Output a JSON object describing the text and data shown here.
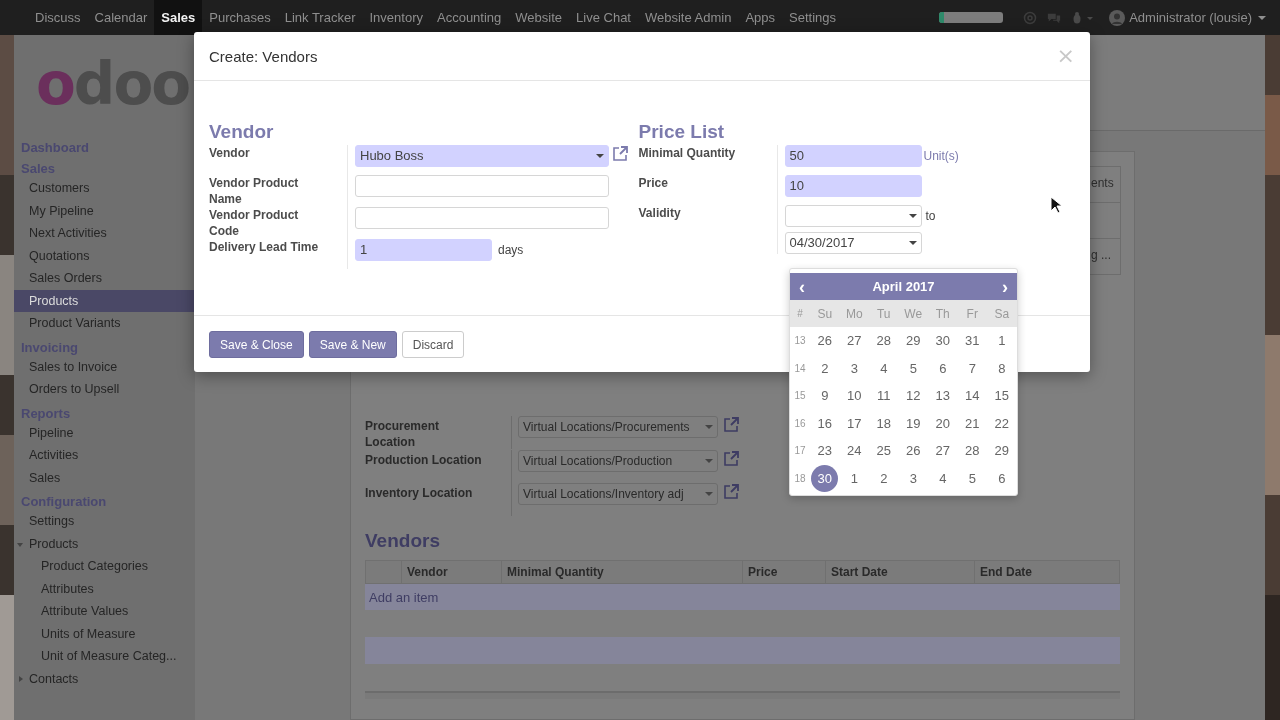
{
  "navbar": {
    "menus": [
      {
        "label": "Discuss",
        "selected": false
      },
      {
        "label": "Calendar",
        "selected": false
      },
      {
        "label": "Sales",
        "selected": true
      },
      {
        "label": "Purchases",
        "selected": false
      },
      {
        "label": "Link Tracker",
        "selected": false
      },
      {
        "label": "Inventory",
        "selected": false
      },
      {
        "label": "Accounting",
        "selected": false
      },
      {
        "label": "Website",
        "selected": false
      },
      {
        "label": "Live Chat",
        "selected": false
      },
      {
        "label": "Website Admin",
        "selected": false
      },
      {
        "label": "Apps",
        "selected": false
      },
      {
        "label": "Settings",
        "selected": false
      }
    ],
    "progress": {
      "level": 0.08
    },
    "user": "Administrator (lousie)"
  },
  "sidebar": {
    "logo": "odoo",
    "sections": [
      {
        "title": "Dashboard"
      },
      {
        "title": "Sales",
        "items": [
          {
            "label": "Customers",
            "selected": false,
            "kind": "leaf"
          },
          {
            "label": "My Pipeline",
            "selected": false,
            "kind": "leaf"
          },
          {
            "label": "Next Activities",
            "selected": false,
            "kind": "leaf"
          },
          {
            "label": "Quotations",
            "selected": false,
            "kind": "leaf"
          },
          {
            "label": "Sales Orders",
            "selected": false,
            "kind": "leaf"
          },
          {
            "label": "Products",
            "selected": true,
            "kind": "leaf"
          },
          {
            "label": "Product Variants",
            "selected": false,
            "kind": "leaf"
          }
        ]
      },
      {
        "title": "Invoicing",
        "items": [
          {
            "label": "Sales to Invoice",
            "selected": false,
            "kind": "leaf"
          },
          {
            "label": "Orders to Upsell",
            "selected": false,
            "kind": "leaf"
          }
        ]
      },
      {
        "title": "Reports",
        "items": [
          {
            "label": "Pipeline",
            "selected": false,
            "kind": "leaf"
          },
          {
            "label": "Activities",
            "selected": false,
            "kind": "leaf"
          },
          {
            "label": "Sales",
            "selected": false,
            "kind": "leaf"
          }
        ]
      },
      {
        "title": "Configuration",
        "items": [
          {
            "label": "Settings",
            "selected": false,
            "kind": "leaf"
          },
          {
            "label": "Products",
            "selected": false,
            "kind": "group",
            "expanded": true,
            "children": [
              {
                "label": "Product Categories",
                "selected": false
              },
              {
                "label": "Attributes",
                "selected": false
              },
              {
                "label": "Attribute Values",
                "selected": false
              },
              {
                "label": "Units of Measure",
                "selected": false
              },
              {
                "label": "Unit of Measure Categ...",
                "selected": false
              }
            ]
          },
          {
            "label": "Contacts",
            "selected": false,
            "kind": "group",
            "expanded": false
          }
        ]
      }
    ]
  },
  "page": {
    "stat_buttons": [
      "ents",
      "g ..."
    ],
    "locations": [
      {
        "label": "Procurement Location",
        "value": "Virtual Locations/Procurements"
      },
      {
        "label": "Production Location",
        "value": "Virtual Locations/Production"
      },
      {
        "label": "Inventory Location",
        "value": "Virtual Locations/Inventory adj"
      }
    ],
    "vendors": {
      "title": "Vendors",
      "columns": [
        "Vendor",
        "Minimal Quantity",
        "Price",
        "Start Date",
        "End Date"
      ],
      "add_item": "Add an item"
    }
  },
  "modal": {
    "title": "Create: Vendors",
    "close": "×",
    "groups": [
      {
        "title": "Vendor",
        "fields": [
          {
            "label": "Vendor",
            "kind": "select",
            "value": "Hubo Boss",
            "required": true,
            "link": true
          },
          {
            "label": "Vendor Product Name",
            "kind": "text",
            "required": false
          },
          {
            "label": "Vendor Product Code",
            "kind": "text",
            "required": false
          },
          {
            "label": "Delivery Lead Time",
            "kind": "text",
            "value": "1",
            "required": true,
            "unit": "days"
          }
        ]
      },
      {
        "title": "Price List",
        "fields": [
          {
            "label": "Minimal Quantity",
            "kind": "text",
            "value": "50",
            "required": true,
            "unit": "Unit(s)"
          },
          {
            "label": "Price",
            "kind": "text",
            "value": "10",
            "required": true
          },
          {
            "label": "Validity",
            "kind": "daterange",
            "separator": "to",
            "end": "04/30/2017"
          }
        ]
      }
    ],
    "buttons": [
      {
        "label": "Save & Close",
        "kind": "primary"
      },
      {
        "label": "Save & New",
        "kind": "primary"
      },
      {
        "label": "Discard",
        "kind": "default"
      }
    ]
  },
  "calendar": {
    "month": "April 2017",
    "prev": "‹",
    "next": "›",
    "week_header": "#",
    "weekdays": [
      "Su",
      "Mo",
      "Tu",
      "We",
      "Th",
      "Fr",
      "Sa"
    ],
    "weeks": [
      {
        "week": "13",
        "days": [
          {
            "d": "26",
            "selected": false
          },
          {
            "d": "27",
            "selected": false
          },
          {
            "d": "28",
            "selected": false
          },
          {
            "d": "29",
            "selected": false
          },
          {
            "d": "30",
            "selected": false
          },
          {
            "d": "31",
            "selected": false
          },
          {
            "d": "1",
            "selected": false
          }
        ]
      },
      {
        "week": "14",
        "days": [
          {
            "d": "2",
            "selected": false
          },
          {
            "d": "3",
            "selected": false
          },
          {
            "d": "4",
            "selected": false
          },
          {
            "d": "5",
            "selected": false
          },
          {
            "d": "6",
            "selected": false
          },
          {
            "d": "7",
            "selected": false
          },
          {
            "d": "8",
            "selected": false
          }
        ]
      },
      {
        "week": "15",
        "days": [
          {
            "d": "9",
            "selected": false
          },
          {
            "d": "10",
            "selected": false
          },
          {
            "d": "11",
            "selected": false
          },
          {
            "d": "12",
            "selected": false
          },
          {
            "d": "13",
            "selected": false
          },
          {
            "d": "14",
            "selected": false
          },
          {
            "d": "15",
            "selected": false
          }
        ]
      },
      {
        "week": "16",
        "days": [
          {
            "d": "16",
            "selected": false
          },
          {
            "d": "17",
            "selected": false
          },
          {
            "d": "18",
            "selected": false
          },
          {
            "d": "19",
            "selected": false
          },
          {
            "d": "20",
            "selected": false
          },
          {
            "d": "21",
            "selected": false
          },
          {
            "d": "22",
            "selected": false
          }
        ]
      },
      {
        "week": "17",
        "days": [
          {
            "d": "23",
            "selected": false
          },
          {
            "d": "24",
            "selected": false
          },
          {
            "d": "25",
            "selected": false
          },
          {
            "d": "26",
            "selected": false
          },
          {
            "d": "27",
            "selected": false
          },
          {
            "d": "28",
            "selected": false
          },
          {
            "d": "29",
            "selected": false
          }
        ]
      },
      {
        "week": "18",
        "days": [
          {
            "d": "30",
            "selected": true
          },
          {
            "d": "1",
            "selected": false
          },
          {
            "d": "2",
            "selected": false
          },
          {
            "d": "3",
            "selected": false
          },
          {
            "d": "4",
            "selected": false
          },
          {
            "d": "5",
            "selected": false
          },
          {
            "d": "6",
            "selected": false
          }
        ]
      }
    ]
  }
}
